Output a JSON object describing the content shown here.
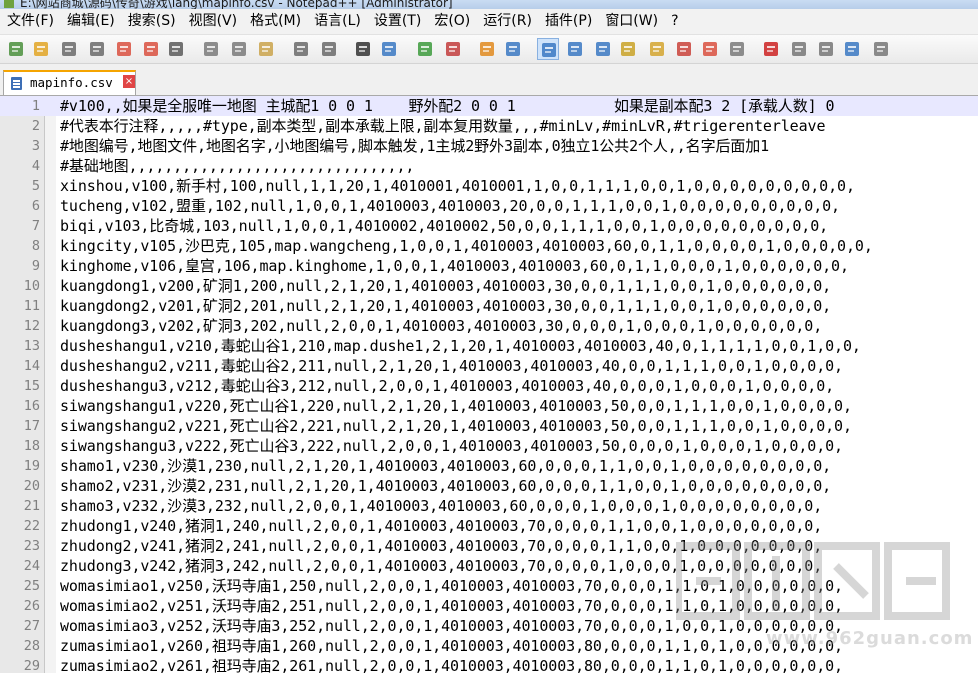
{
  "window": {
    "title": "E:\\网站商城\\源码\\传奇\\游戏\\lang\\mapinfo.csv - Notepad++ [Administrator]"
  },
  "menu": [
    "文件(F)",
    "编辑(E)",
    "搜索(S)",
    "视图(V)",
    "格式(M)",
    "语言(L)",
    "设置(T)",
    "宏(O)",
    "运行(R)",
    "插件(P)",
    "窗口(W)",
    "?"
  ],
  "toolbar": {
    "icons": [
      "new-file-icon",
      "open-file-icon",
      "save-icon",
      "save-all-icon",
      "close-icon",
      "close-all-icon",
      "print-icon",
      "cut-icon",
      "copy-icon",
      "paste-icon",
      "undo-icon",
      "redo-icon",
      "find-icon",
      "replace-icon",
      "zoom-in-icon",
      "zoom-out-icon",
      "sync-vertical-icon",
      "sync-horizontal-icon",
      "word-wrap-icon",
      "show-all-chars-icon",
      "indent-guide-icon",
      "udl-icon",
      "doc-map-icon",
      "function-list-icon",
      "folder-workspace-icon",
      "monitoring-icon",
      "record-macro-icon",
      "stop-record-icon",
      "play-macro-icon",
      "run-macro-multiple-icon",
      "save-macro-icon"
    ]
  },
  "tab": {
    "label": "mapinfo.csv",
    "close": "×"
  },
  "editor": {
    "lines": [
      {
        "n": "1",
        "text": "#v100,,如果是全服唯一地图 主城配1 0 0 1    野外配2 0 0 1           如果是副本配3 2 [承载人数] 0"
      },
      {
        "n": "2",
        "text": "#代表本行注释,,,,,#type,副本类型,副本承载上限,副本复用数量,,,#minLv,#minLvR,#trigerenterleave"
      },
      {
        "n": "3",
        "text": "#地图编号,地图文件,地图名字,小地图编号,脚本触发,1主城2野外3副本,0独立1公共2个人,,名字后面加1"
      },
      {
        "n": "4",
        "text": "#基础地图,,,,,,,,,,,,,,,,,,,,,,,,,,,,,,,,"
      },
      {
        "n": "5",
        "text": "xinshou,v100,新手村,100,null,1,1,20,1,4010001,4010001,1,0,0,1,1,1,0,0,1,0,0,0,0,0,0,0,0,0,"
      },
      {
        "n": "6",
        "text": "tucheng,v102,盟重,102,null,1,0,0,1,4010003,4010003,20,0,0,1,1,1,0,0,1,0,0,0,0,0,0,0,0,0,"
      },
      {
        "n": "7",
        "text": "biqi,v103,比奇城,103,null,1,0,0,1,4010002,4010002,50,0,0,1,1,1,0,0,1,0,0,0,0,0,0,0,0,0,"
      },
      {
        "n": "8",
        "text": "kingcity,v105,沙巴克,105,map.wangcheng,1,0,0,1,4010003,4010003,60,0,1,1,0,0,0,0,1,0,0,0,0,0,"
      },
      {
        "n": "9",
        "text": "kinghome,v106,皇宫,106,map.kinghome,1,0,0,1,4010003,4010003,60,0,1,1,0,0,0,1,0,0,0,0,0,0,"
      },
      {
        "n": "10",
        "text": "kuangdong1,v200,矿洞1,200,null,2,1,20,1,4010003,4010003,30,0,0,1,1,1,0,0,1,0,0,0,0,0,0,"
      },
      {
        "n": "11",
        "text": "kuangdong2,v201,矿洞2,201,null,2,1,20,1,4010003,4010003,30,0,0,1,1,1,0,0,1,0,0,0,0,0,0,"
      },
      {
        "n": "12",
        "text": "kuangdong3,v202,矿洞3,202,null,2,0,0,1,4010003,4010003,30,0,0,0,1,0,0,0,1,0,0,0,0,0,0,"
      },
      {
        "n": "13",
        "text": "dusheshangu1,v210,毒蛇山谷1,210,map.dushe1,2,1,20,1,4010003,4010003,40,0,1,1,1,1,0,0,1,0,0,"
      },
      {
        "n": "14",
        "text": "dusheshangu2,v211,毒蛇山谷2,211,null,2,1,20,1,4010003,4010003,40,0,0,1,1,1,0,0,1,0,0,0,0,"
      },
      {
        "n": "15",
        "text": "dusheshangu3,v212,毒蛇山谷3,212,null,2,0,0,1,4010003,4010003,40,0,0,0,1,0,0,0,1,0,0,0,0,"
      },
      {
        "n": "16",
        "text": "siwangshangu1,v220,死亡山谷1,220,null,2,1,20,1,4010003,4010003,50,0,0,1,1,1,0,0,1,0,0,0,0,"
      },
      {
        "n": "17",
        "text": "siwangshangu2,v221,死亡山谷2,221,null,2,1,20,1,4010003,4010003,50,0,0,1,1,1,0,0,1,0,0,0,0,"
      },
      {
        "n": "18",
        "text": "siwangshangu3,v222,死亡山谷3,222,null,2,0,0,1,4010003,4010003,50,0,0,0,1,0,0,0,1,0,0,0,0,"
      },
      {
        "n": "19",
        "text": "shamo1,v230,沙漠1,230,null,2,1,20,1,4010003,4010003,60,0,0,0,1,1,0,0,1,0,0,0,0,0,0,0,0,"
      },
      {
        "n": "20",
        "text": "shamo2,v231,沙漠2,231,null,2,1,20,1,4010003,4010003,60,0,0,0,1,1,0,0,1,0,0,0,0,0,0,0,0,"
      },
      {
        "n": "21",
        "text": "shamo3,v232,沙漠3,232,null,2,0,0,1,4010003,4010003,60,0,0,0,1,0,0,0,1,0,0,0,0,0,0,0,0,"
      },
      {
        "n": "22",
        "text": "zhudong1,v240,猪洞1,240,null,2,0,0,1,4010003,4010003,70,0,0,0,1,1,0,0,1,0,0,0,0,0,0,0,"
      },
      {
        "n": "23",
        "text": "zhudong2,v241,猪洞2,241,null,2,0,0,1,4010003,4010003,70,0,0,0,1,1,0,0,1,0,0,0,0,0,0,0,"
      },
      {
        "n": "24",
        "text": "zhudong3,v242,猪洞3,242,null,2,0,0,1,4010003,4010003,70,0,0,0,1,0,0,0,1,0,0,0,0,0,0,0,"
      },
      {
        "n": "25",
        "text": "womasimiao1,v250,沃玛寺庙1,250,null,2,0,0,1,4010003,4010003,70,0,0,0,1,1,0,1,0,0,0,0,0,0,"
      },
      {
        "n": "26",
        "text": "womasimiao2,v251,沃玛寺庙2,251,null,2,0,0,1,4010003,4010003,70,0,0,0,1,1,0,1,0,0,0,0,0,0,"
      },
      {
        "n": "27",
        "text": "womasimiao3,v252,沃玛寺庙3,252,null,2,0,0,1,4010003,4010003,70,0,0,0,1,0,0,1,0,0,0,0,0,0,"
      },
      {
        "n": "28",
        "text": "zumasimiao1,v260,祖玛寺庙1,260,null,2,0,0,1,4010003,4010003,80,0,0,0,1,1,0,1,0,0,0,0,0,0,"
      },
      {
        "n": "29",
        "text": "zumasimiao2,v261,祖玛寺庙2,261,null,2,0,0,1,4010003,4010003,80,0,0,0,1,1,0,1,0,0,0,0,0,0,"
      }
    ]
  },
  "watermark": {
    "text": "www.962guan.com"
  }
}
